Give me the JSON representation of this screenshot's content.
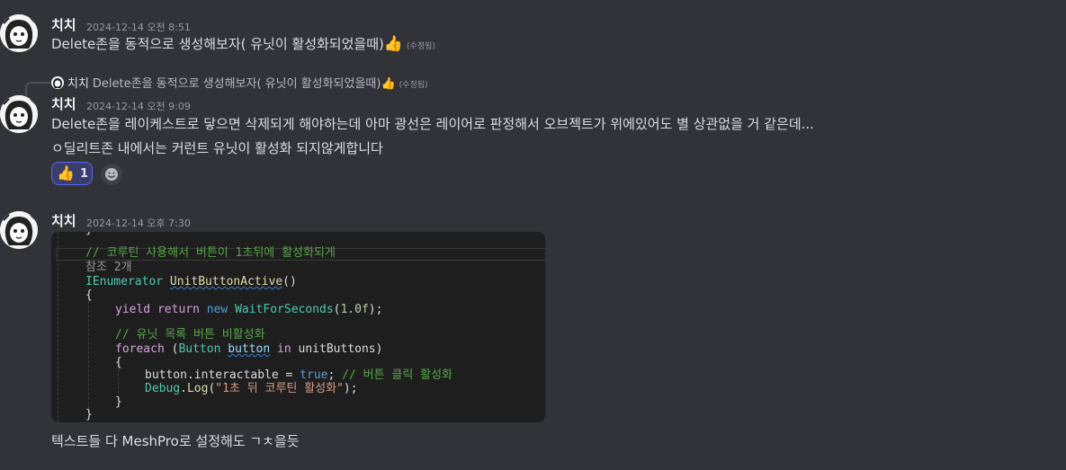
{
  "messages": [
    {
      "author": "치치",
      "timestamp": "2024-12-14 오전 8:51",
      "text": "Delete존을 동적으로 생성해보자( 유닛이 활성화되었을때)",
      "emoji": "👍",
      "edited": "(수정됨)"
    },
    {
      "reply": {
        "author": "치치",
        "text": "Delete존을 동적으로 생성해보자( 유닛이 활성화되었을때)",
        "emoji": "👍",
        "edited": "(수정됨)"
      },
      "author": "치치",
      "timestamp": "2024-12-14 오전 9:09",
      "line1": "Delete존을 레이케스트로 닿으면 삭제되게 해야하는데 아마 광선은 레이어로 판정해서 오브젝트가 위에있어도 별 상관없을 거 같은데...",
      "line2": "ㅇ딜리트존 내에서는 커런트 유닛이 활성화 되지않게합니다",
      "reaction": {
        "emoji": "👍",
        "count": "1"
      },
      "add_reaction_icon": "smile-add-icon"
    },
    {
      "author": "치치",
      "timestamp": "2024-12-14 오후 7:30",
      "code_lines": {
        "brace_top": "}",
        "comment1": "// 코루틴 사용해서 버튼이 1초뒤에 활성화되게",
        "refs": "참조 2개",
        "type": "IEnumerator",
        "method": "UnitButtonActive",
        "parens": "()",
        "open1": "{",
        "yield": "yield",
        "return": "return",
        "new": "new",
        "wait": "WaitForSeconds",
        "lp": "(",
        "num": "1.0f",
        "rp_semi": ");",
        "comment2": "// 유닛 목록 버튼 비활성화",
        "foreach": "foreach",
        "fe_lp": " (",
        "btn_type": "Button",
        "btn_var": "button",
        "in_kw": "in",
        "collection": "unitButtons)",
        "open2": "{",
        "assign_lhs": "button.interactable = ",
        "true_kw": "true",
        "semi": ";",
        "comment3": "// 버튼 클릭 활성화",
        "debug": "Debug",
        "dot": ".",
        "log": "Log",
        "log_lp": "(",
        "str": "\"1초 뒤 코루틴 활성화\"",
        "log_rp": ");",
        "close2": "}",
        "close1": "}"
      },
      "text_after": "텍스트들 다 MeshPro로 설정해도 ㄱㅊ을듯"
    }
  ],
  "colors": {
    "background": "#323339",
    "reaction_bg": "#3b3e6b",
    "reaction_border": "#5865f2",
    "code_bg": "#1e1e1e"
  }
}
